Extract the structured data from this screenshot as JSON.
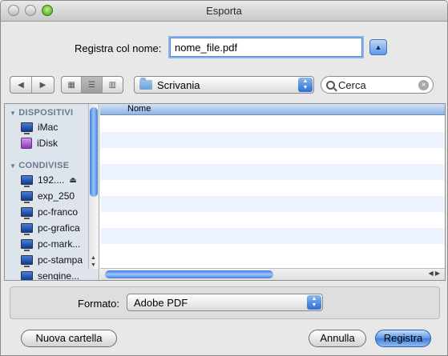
{
  "window": {
    "title": "Esporta"
  },
  "save": {
    "label": "Registra col nome:",
    "filename": "nome_file.pdf",
    "disclosure": "▲"
  },
  "toolbar": {
    "back": "◀",
    "forward": "▶",
    "view_icons": "▦",
    "view_list": "☰",
    "view_columns": "▥",
    "location": "Scrivania",
    "search_value": "Cerca"
  },
  "sidebar": {
    "sections": [
      {
        "label": "DISPOSITIVI",
        "items": [
          {
            "label": "iMac",
            "icon": "imac-icon"
          },
          {
            "label": "iDisk",
            "icon": "idisk-icon"
          }
        ]
      },
      {
        "label": "CONDIVISE",
        "items": [
          {
            "label": "192....",
            "icon": "network-mac-icon",
            "eject": "⏏"
          },
          {
            "label": "exp_250",
            "icon": "network-mac-icon"
          },
          {
            "label": "pc-franco",
            "icon": "network-pc-icon"
          },
          {
            "label": "pc-grafica",
            "icon": "network-pc-icon"
          },
          {
            "label": "pc-mark...",
            "icon": "network-pc-icon"
          },
          {
            "label": "pc-stampa",
            "icon": "network-pc-icon"
          },
          {
            "label": "sengine...",
            "icon": "network-pc-icon"
          }
        ]
      }
    ]
  },
  "file_list": {
    "column_name": "Nome",
    "rows": []
  },
  "format": {
    "label": "Formato:",
    "value": "Adobe PDF"
  },
  "buttons": {
    "new_folder": "Nuova cartella",
    "cancel": "Annulla",
    "save": "Registra"
  },
  "colors": {
    "accent": "#3f7fdb",
    "sidebar_bg": "#dde4ec",
    "alt_row": "#edf3fe"
  }
}
